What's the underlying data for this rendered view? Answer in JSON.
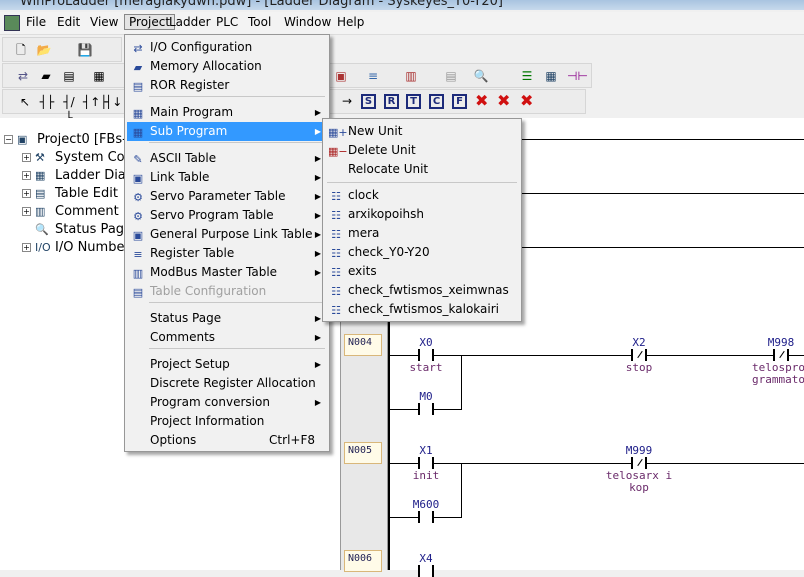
{
  "window": {
    "title": "WinProLadder [meragiakydwn.pdw] - [Ladder Diagram - Syskeyes_Y0-Y20]"
  },
  "menubar": [
    "File",
    "Edit",
    "View",
    "Project",
    "Ladder",
    "PLC",
    "Tool",
    "Window",
    "Help"
  ],
  "toolbar": {
    "contact_buttons": [
      "S",
      "R",
      "T",
      "C",
      "F"
    ]
  },
  "tree": {
    "root": "Project0 [FBs-",
    "items": [
      "System Co",
      "Ladder Dia",
      "Table Edit",
      "Comment",
      "Status Pag",
      "I/O Numbe"
    ]
  },
  "project_menu": {
    "items": [
      {
        "label": "I/O Configuration",
        "icon": "io-config-icon"
      },
      {
        "label": "Memory Allocation",
        "icon": "memory-chip-icon"
      },
      {
        "label": "ROR Register",
        "icon": "ror-register-icon"
      },
      {
        "label": "Main Program",
        "icon": "main-program-icon",
        "submenu": true
      },
      {
        "label": "Sub Program",
        "icon": "sub-program-icon",
        "submenu": true,
        "highlighted": true
      },
      {
        "label": "ASCII Table",
        "icon": "ascii-table-icon",
        "submenu": true
      },
      {
        "label": "Link Table",
        "icon": "link-table-icon",
        "submenu": true
      },
      {
        "label": "Servo Parameter Table",
        "icon": "servo-parameter-icon",
        "submenu": true
      },
      {
        "label": "Servo Program Table",
        "icon": "servo-program-icon",
        "submenu": true
      },
      {
        "label": "General Purpose Link Table",
        "icon": "general-link-icon",
        "submenu": true
      },
      {
        "label": "Register Table",
        "icon": "register-table-icon",
        "submenu": true
      },
      {
        "label": "ModBus Master Table",
        "icon": "modbus-icon",
        "submenu": true
      },
      {
        "label": "Table Configuration",
        "icon": "table-config-icon",
        "disabled": true
      },
      {
        "label": "Status Page",
        "submenu": true
      },
      {
        "label": "Comments",
        "submenu": true
      },
      {
        "label": "Project Setup",
        "submenu": true
      },
      {
        "label": "Discrete  Register Allocation"
      },
      {
        "label": "Program conversion",
        "submenu": true
      },
      {
        "label": "Project Information"
      },
      {
        "label": "Options",
        "shortcut": "Ctrl+F8"
      }
    ]
  },
  "sub_program_menu": {
    "actions": [
      "New Unit",
      "Delete Unit",
      "Relocate Unit"
    ],
    "units": [
      "clock",
      "arxikopoihsh",
      "mera",
      "check_Y0-Y20",
      "exits",
      "check_fwtismos_xeimwnas",
      "check_fwtismos_kalokairi"
    ]
  },
  "ladder": {
    "networks": [
      {
        "label": "N004",
        "contacts": [
          {
            "addr": "X0",
            "comment": "start",
            "type": "NO"
          },
          {
            "addr": "M0",
            "comment": "",
            "type": "NO"
          },
          {
            "addr": "X2",
            "comment": "stop",
            "type": "NC"
          },
          {
            "addr": "M998",
            "comment": "telospro grammato",
            "type": "NC"
          }
        ]
      },
      {
        "label": "N005",
        "contacts": [
          {
            "addr": "X1",
            "comment": "init",
            "type": "NO"
          },
          {
            "addr": "M600",
            "comment": "",
            "type": "NO"
          },
          {
            "addr": "M999",
            "comment": "telosarx ikop",
            "type": "NC"
          }
        ]
      },
      {
        "label": "N006",
        "contacts": [
          {
            "addr": "X4",
            "comment": "",
            "type": "NO"
          }
        ]
      }
    ]
  },
  "colors": {
    "highlight": "#3399ff",
    "address": "#20208a",
    "comment": "#6a2a6a"
  }
}
